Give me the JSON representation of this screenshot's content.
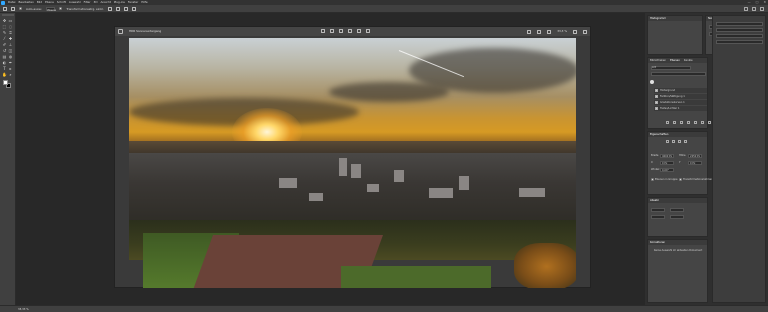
{
  "app": {
    "menu": [
      "Datei",
      "Bearbeiten",
      "Bild",
      "Ebene",
      "Schrift",
      "Auswahl",
      "Filter",
      "3D",
      "Ansicht",
      "Plug-ins",
      "Fenster",
      "Hilfe"
    ],
    "window_controls": [
      "—",
      "□",
      "✕"
    ]
  },
  "options_bar": {
    "label_1": "Auto-ausw.:",
    "label_2": "Ebene",
    "label_3": "Transformationsstrg. einbl."
  },
  "document": {
    "name": "HDR Sonnenuntergang",
    "zoom": "33,3 %"
  },
  "panels": {
    "histogram_tab": "Histogramm",
    "navigator_tab": "Navigator",
    "info_tab": "Info",
    "layers_tabs": [
      "Bibliotheken",
      "Ebenen",
      "Kanäle",
      "Pfade"
    ],
    "layers_header": "Art",
    "layers": [
      {
        "name": "Hintergrund"
      },
      {
        "name": "Farbton/Sättigung 1"
      },
      {
        "name": "Gradationskurven 1"
      },
      {
        "name": "Tiefen/Lichter 1"
      }
    ],
    "align_tab": "Ausrichten",
    "transform_tab": "Eigenschaften",
    "props_labels": [
      "Breite",
      "Höhe",
      "X",
      "Y",
      "Winkel"
    ],
    "props_values": [
      "4000 Px",
      "2250 Px",
      "0 Px",
      "0 Px",
      "0,00°"
    ],
    "checkbox_1": "Ebenen in Gruppe",
    "checkbox_2": "Transformationsrahmen",
    "extra_tab": "Absatz",
    "adjust_tab": "Korrekturen",
    "adjust_text": "Keine Auswahl im aktuellen Dokument"
  },
  "status": {
    "zoom": "33,33 %"
  }
}
